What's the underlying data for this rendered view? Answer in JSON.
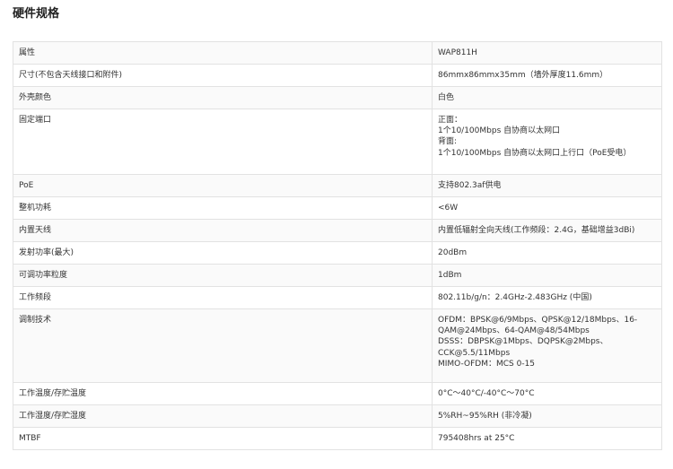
{
  "title": "硬件规格",
  "rows": [
    {
      "label": "属性",
      "value": [
        "WAP811H"
      ]
    },
    {
      "label": "尺寸(不包含天线接口和附件)",
      "value": [
        "86mmx86mmx35mm（墙外厚度11.6mm）"
      ]
    },
    {
      "label": "外壳颜色",
      "value": [
        "白色"
      ]
    },
    {
      "label": "固定端口",
      "value": [
        "正面：",
        "1个10/100Mbps 自协商以太网口",
        "背面:",
        "1个10/100Mbps 自协商以太网口上行口（PoE受电）"
      ]
    },
    {
      "label": "PoE",
      "value": [
        "支持802.3af供电"
      ]
    },
    {
      "label": "整机功耗",
      "value": [
        "<6W"
      ]
    },
    {
      "label": "内置天线",
      "value": [
        "内置低辐射全向天线(工作频段：2.4G，基础增益3dBi)"
      ]
    },
    {
      "label": "发射功率(最大)",
      "value": [
        "20dBm"
      ]
    },
    {
      "label": "可调功率粒度",
      "value": [
        "1dBm"
      ]
    },
    {
      "label": "工作频段",
      "value": [
        "802.11b/g/n：2.4GHz-2.483GHz (中国)"
      ]
    },
    {
      "label": "调制技术",
      "value": [
        "OFDM：BPSK@6/9Mbps、QPSK@12/18Mbps、16-",
        "QAM@24Mbps、64-QAM@48/54Mbps",
        "DSSS：DBPSK@1Mbps、DQPSK@2Mbps、",
        "CCK@5.5/11Mbps",
        "MIMO-OFDM：MCS 0-15"
      ]
    },
    {
      "label": "工作温度/存贮温度",
      "value": [
        "0°C～40°C/-40°C～70°C"
      ]
    },
    {
      "label": "工作湿度/存贮湿度",
      "value": [
        "5%RH~95%RH (非冷凝)"
      ]
    },
    {
      "label": "MTBF",
      "value": [
        "795408hrs at 25°C"
      ]
    }
  ]
}
